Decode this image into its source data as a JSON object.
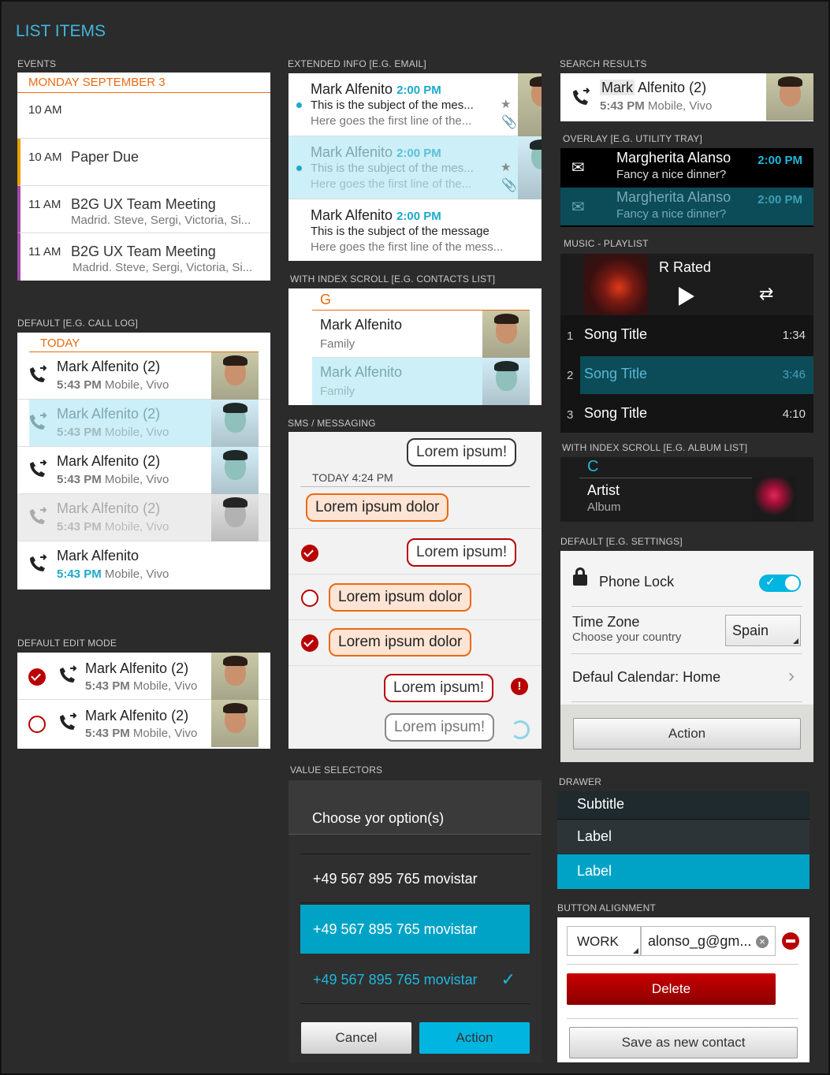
{
  "page_title": "LIST ITEMS",
  "events": {
    "section": "EVENTS",
    "date": "MONDAY SEPTEMBER 3",
    "rows": [
      {
        "time": "10 AM",
        "title": "",
        "detail": ""
      },
      {
        "time": "10 AM",
        "title": "Paper Due",
        "detail": ""
      },
      {
        "time": "11 AM",
        "title": "B2G UX Team Meeting",
        "detail": "Madrid. Steve, Sergi, Victoria, Si..."
      },
      {
        "time": "11 AM",
        "title": "B2G UX Team Meeting",
        "detail": "Madrid. Steve, Sergi, Victoria, Si..."
      }
    ]
  },
  "call_log": {
    "section": "DEFAULT [E.G. CALL LOG]",
    "header": "TODAY",
    "rows": [
      {
        "first": "Mark",
        "last": "Alfenito",
        "count": "(2)",
        "time": "5:43 PM",
        "info": "Mobile, Vivo"
      },
      {
        "first": "Mark",
        "last": "Alfenito",
        "count": "(2)",
        "time": "5:43 PM",
        "info": "Mobile, Vivo"
      },
      {
        "first": "Mark",
        "last": "Alfenito",
        "count": "(2)",
        "time": "5:43 PM",
        "info": "Mobile, Vivo"
      },
      {
        "first": "Mark",
        "last": "Alfenito",
        "count": "(2)",
        "time": "5:43 PM",
        "info": "Mobile, Vivo"
      },
      {
        "first": "Mark",
        "last": "Alfenito",
        "count": "",
        "time": "5:43 PM",
        "info": "Mobile, Vivo"
      }
    ]
  },
  "edit_mode": {
    "section": "DEFAULT EDIT MODE",
    "rows": [
      {
        "first": "Mark",
        "last": "Alfenito",
        "count": "(2)",
        "time": "5:43 PM",
        "info": "Mobile, Vivo"
      },
      {
        "first": "Mark",
        "last": "Alfenito",
        "count": "(2)",
        "time": "5:43 PM",
        "info": "Mobile, Vivo"
      }
    ]
  },
  "email": {
    "section": "EXTENDED INFO [E.G. EMAIL]",
    "rows": [
      {
        "first": "Mark",
        "last": "Alfenito",
        "time": "2:00 PM",
        "subject": "This is the subject of the mes...",
        "preview": "Here goes the first line of the..."
      },
      {
        "first": "Mark",
        "last": "Alfenito",
        "time": "2:00 PM",
        "subject": "This is the subject of the mes...",
        "preview": "Here goes the first line of the..."
      },
      {
        "first": "Mark",
        "last": "Alfenito",
        "time": "2:00 PM",
        "subject": "This is the subject of the message",
        "preview": "Here goes the first line of the mess..."
      }
    ]
  },
  "contacts": {
    "section": "WITH INDEX SCROLL [E.G. CONTACTS LIST]",
    "letter": "G",
    "rows": [
      {
        "first": "Mark",
        "last": "Alfenito",
        "sub": "Family"
      },
      {
        "first": "Mark",
        "last": "Alfenito",
        "sub": "Family"
      }
    ]
  },
  "sms": {
    "section": "SMS / MESSAGING",
    "date": "TODAY 4:24 PM",
    "msgs": [
      "Lorem ipsum!",
      "Lorem ipsum dolor",
      "Lorem ipsum!",
      "Lorem ipsum dolor",
      "Lorem ipsum dolor",
      "Lorem ipsum!",
      "Lorem ipsum!"
    ]
  },
  "value_selectors": {
    "section": "VALUE SELECTORS",
    "title": "Choose yor option(s)",
    "options": [
      "+49 567 895 765  movistar",
      "+49 567 895 765  movistar",
      "+49 567 895 765  movistar"
    ],
    "cancel": "Cancel",
    "action": "Action"
  },
  "search": {
    "section": "SEARCH RESULTS",
    "first": "Mark",
    "last": "Alfenito",
    "count": "(2)",
    "time": "5:43 PM",
    "info": "Mobile, Vivo"
  },
  "overlay": {
    "section": "OVERLAY [E.G. UTILITY TRAY]",
    "rows": [
      {
        "name": "Margherita Alanso",
        "msg": "Fancy a nice dinner?",
        "time": "2:00 PM"
      },
      {
        "name": "Margherita Alanso",
        "msg": "Fancy a nice dinner?",
        "time": "2:00 PM"
      }
    ]
  },
  "music": {
    "section": "MUSIC - PLAYLIST",
    "album": "R Rated",
    "songs": [
      {
        "n": "1",
        "title": "Song Title",
        "dur": "1:34"
      },
      {
        "n": "2",
        "title": "Song Title",
        "dur": "3:46"
      },
      {
        "n": "3",
        "title": "Song Title",
        "dur": "4:10"
      }
    ]
  },
  "album_list": {
    "section": "WITH INDEX SCROLL [E.G. ALBUM LIST]",
    "letter": "C",
    "artist": "Artist",
    "album": "Album"
  },
  "settings": {
    "section": "DEFAULT [E.G. SETTINGS]",
    "phone_lock": "Phone Lock",
    "tz_title": "Time Zone",
    "tz_sub": "Choose your country",
    "tz_value": "Spain",
    "calendar": "Defaul Calendar: Home",
    "action": "Action"
  },
  "drawer": {
    "section": "DRAWER",
    "subtitle": "Subtitle",
    "label1": "Label",
    "label2": "Label"
  },
  "button_alignment": {
    "section": "BUTTON ALIGNMENT",
    "type": "WORK",
    "email": "alonso_g@gm...",
    "delete": "Delete",
    "save": "Save as new contact"
  },
  "colors": {
    "accent_blue": "#00a3c6",
    "orange": "#ea6a10",
    "red": "#b90000"
  }
}
